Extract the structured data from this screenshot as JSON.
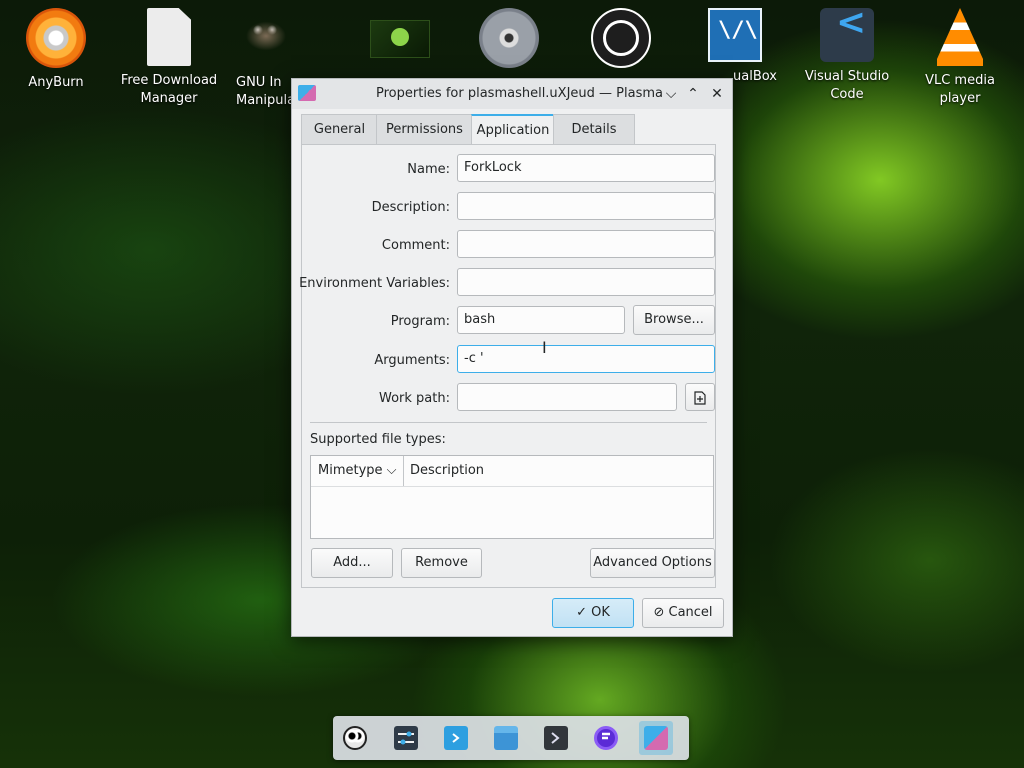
{
  "desktop": {
    "icons": [
      {
        "label": "AnyBurn",
        "icon": "anyburn-icon"
      },
      {
        "label": "Free Download Manager",
        "icon": "free-download-manager-icon"
      },
      {
        "label": "GNU Image Manipulation",
        "icon": "gimp-icon"
      },
      {
        "label": "",
        "icon": "linux-mint-icon"
      },
      {
        "label": "",
        "icon": "cd-disc-icon"
      },
      {
        "label": "",
        "icon": "obs-studio-icon"
      },
      {
        "label": "VirtualBox",
        "icon": "virtualbox-icon"
      },
      {
        "label": "Visual Studio Code",
        "icon": "vscode-icon"
      },
      {
        "label": "VLC media player",
        "icon": "vlc-icon"
      }
    ],
    "gimp_visible_label_1": "GNU In",
    "gimp_visible_label_2": "Manipula",
    "virtualbox_visible_label": "ualBox",
    "vscode_line1": "Visual Studio",
    "vscode_line2": "Code",
    "vlc_line1": "VLC media",
    "vlc_line2": "player",
    "fdm_line1": "Free Download",
    "fdm_line2": "Manager"
  },
  "dialog": {
    "title": "Properties for plasmashell.uXJeud — Plasma",
    "controls": {
      "minimize": "⌵",
      "maximize": "⌃",
      "close": "✕"
    },
    "tabs": [
      {
        "label": "General",
        "active": false
      },
      {
        "label": "Permissions",
        "active": false
      },
      {
        "label": "Application",
        "active": true
      },
      {
        "label": "Details",
        "active": false
      }
    ],
    "form": {
      "name_label": "Name:",
      "name_value": "ForkLock",
      "description_label": "Description:",
      "description_value": "",
      "comment_label": "Comment:",
      "comment_value": "",
      "env_label": "Environment Variables:",
      "env_value": "",
      "program_label": "Program:",
      "program_value": "bash",
      "browse_label": "Browse...",
      "arguments_label": "Arguments:",
      "arguments_value": "-c '",
      "workpath_label": "Work path:",
      "workpath_value": ""
    },
    "filetypes": {
      "section_label": "Supported file types:",
      "columns": [
        "Mimetype",
        "Description"
      ],
      "rows": []
    },
    "buttons": {
      "add": "Add...",
      "remove": "Remove",
      "advanced": "Advanced Options",
      "ok": "OK",
      "cancel": "Cancel"
    }
  },
  "taskbar": {
    "items": [
      {
        "icon": "panda-avatar-icon",
        "active": false
      },
      {
        "icon": "system-settings-icon",
        "active": false
      },
      {
        "icon": "discover-store-icon",
        "active": false
      },
      {
        "icon": "file-manager-icon",
        "active": false
      },
      {
        "icon": "terminal-icon",
        "active": false
      },
      {
        "icon": "firefox-like-icon",
        "active": false
      },
      {
        "icon": "plasma-properties-icon",
        "active": true
      }
    ]
  },
  "colors": {
    "accent": "#3daee9",
    "dialog_bg": "#eff0f1",
    "wallpaper_glow": "#8dd44a"
  }
}
